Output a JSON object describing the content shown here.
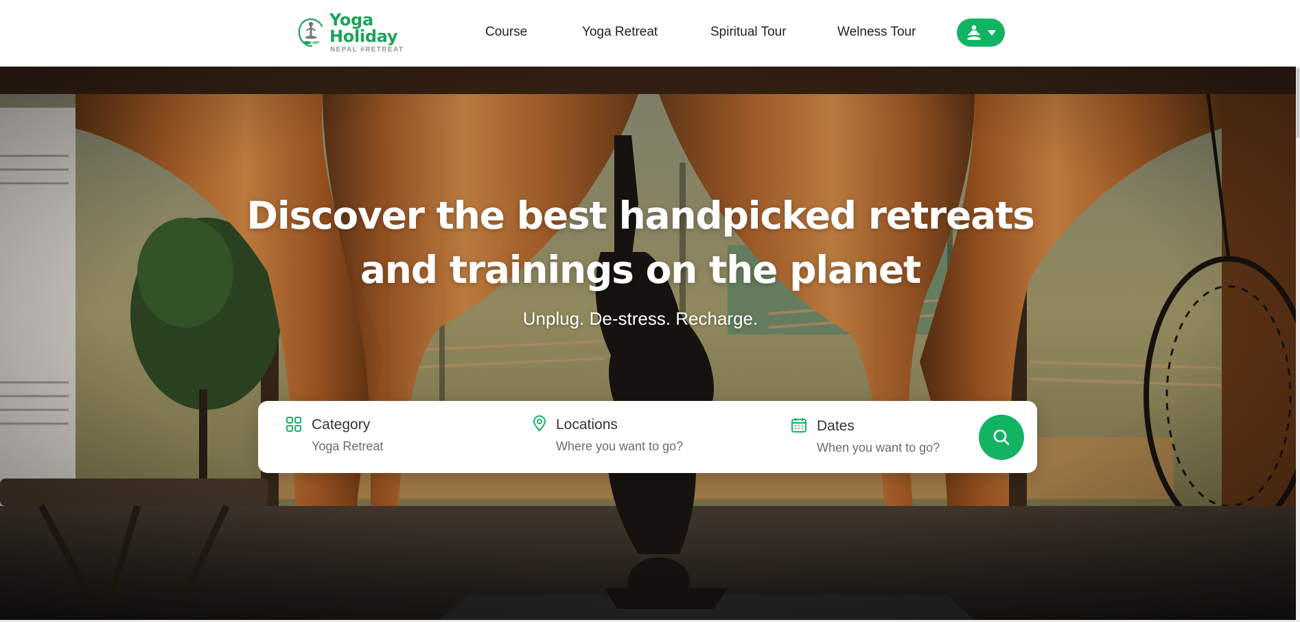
{
  "brand": {
    "name": "Yoga Holiday",
    "tagline": "NEPAL #RETREAT",
    "color": "#1ba35a"
  },
  "nav": {
    "items": [
      {
        "label": "Course"
      },
      {
        "label": "Yoga Retreat"
      },
      {
        "label": "Spiritual Tour"
      },
      {
        "label": "Welness Tour"
      }
    ],
    "user_menu_icon": "meditation-user-icon",
    "dropdown_icon": "caret-down-icon",
    "accent": "#12b464"
  },
  "hero": {
    "title": "Discover the best handpicked retreats and trainings on the planet",
    "subtitle": "Unplug. De-stress. Recharge."
  },
  "search": {
    "category": {
      "label": "Category",
      "value": "Yoga Retreat",
      "icon": "grid-icon"
    },
    "location": {
      "label": "Locations",
      "placeholder": "Where you want to go?",
      "icon": "map-pin-icon"
    },
    "dates": {
      "label": "Dates",
      "placeholder": "When you want to go?",
      "icon": "calendar-icon"
    },
    "button_icon": "search-icon"
  }
}
